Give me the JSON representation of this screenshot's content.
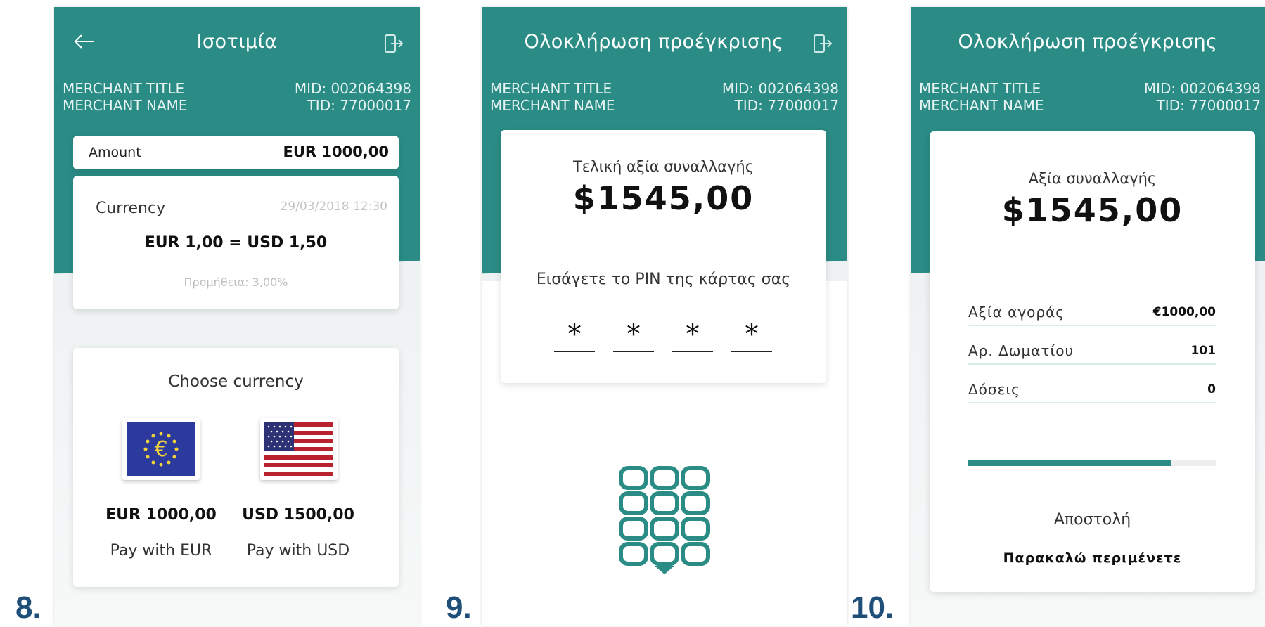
{
  "colors": {
    "accent": "#2a8c85",
    "step_number": "#1f4e79"
  },
  "steps": [
    "8.",
    "9.",
    "10."
  ],
  "screen8": {
    "title": "Ισοτιμία",
    "merchant_title": "MERCHANT TITLE",
    "merchant_name": "MERCHANT NAME",
    "mid": "MID: 002064398",
    "tid": "TID: 77000017",
    "amount_label": "Amount",
    "amount_value": "EUR 1000,00",
    "currency_label": "Currency",
    "currency_date": "29/03/2018 12:30",
    "rate": "EUR 1,00 = USD 1,50",
    "fee": "Προμήθεια: 3,00%",
    "choose_title": "Choose currency",
    "options": [
      {
        "icon": "eu-flag-icon",
        "amount": "EUR 1000,00",
        "label": "Pay with EUR"
      },
      {
        "icon": "us-flag-icon",
        "amount": "USD 1500,00",
        "label": "Pay with USD"
      }
    ]
  },
  "screen9": {
    "title": "Ολοκλήρωση προέγκρισης",
    "merchant_title": "MERCHANT TITLE",
    "merchant_name": "MERCHANT NAME",
    "mid": "MID: 002064398",
    "tid": "TID: 77000017",
    "caption": "Τελική αξία συναλλαγής",
    "amount": "$1545,00",
    "pin_prompt": "Εισάγετε το PIN της κάρτας σας",
    "pin_digits": [
      "*",
      "*",
      "*",
      "*"
    ],
    "keypad_icon": "pin-keypad-icon"
  },
  "screen10": {
    "title": "Ολοκλήρωση προέγκρισης",
    "merchant_title": "MERCHANT TITLE",
    "merchant_name": "MERCHANT NAME",
    "mid": "MID: 002064398",
    "tid": "TID: 77000017",
    "caption": "Αξία συναλλαγής",
    "amount": "$1545,00",
    "rows": [
      {
        "label": "Αξία αγοράς",
        "value": "€1000,00"
      },
      {
        "label": "Αρ. Δωματίου",
        "value": "101"
      },
      {
        "label": "Δόσεις",
        "value": "0"
      }
    ],
    "progress": 0.82,
    "status": "Αποστολή",
    "wait": "Παρακαλώ περιμένετε"
  }
}
